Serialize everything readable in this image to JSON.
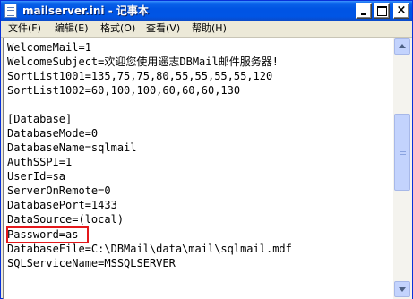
{
  "window": {
    "title": "mailserver.ini - 记事本",
    "icon": "notepad-icon",
    "caption_buttons": {
      "minimize": "minimize-icon",
      "maximize": "maximize-icon",
      "close": "×"
    }
  },
  "menubar": {
    "items": [
      {
        "label": "文件(F)"
      },
      {
        "label": "编辑(E)"
      },
      {
        "label": "格式(O)"
      },
      {
        "label": "查看(V)"
      },
      {
        "label": "帮助(H)"
      }
    ]
  },
  "editor": {
    "lines": [
      "WelcomeMail=1",
      "WelcomeSubject=欢迎您使用遥志DBMail邮件服务器!",
      "SortList1001=135,75,75,80,55,55,55,55,120",
      "SortList1002=60,100,100,60,60,60,130",
      "",
      "[Database]",
      "DatabaseMode=0",
      "DatabaseName=sqlmail",
      "AuthSSPI=1",
      "UserId=sa",
      "ServerOnRemote=0",
      "DatabasePort=1433",
      "DataSource=(local)",
      "Password=as",
      "DatabaseFile=C:\\DBMail\\data\\mail\\sqlmail.mdf",
      "SQLServiceName=MSSQLSERVER"
    ],
    "highlight_color": "#e4181b"
  },
  "scrollbar": {
    "up_icon": "scroll-up-arrow-icon",
    "down_icon": "scroll-down-arrow-icon"
  }
}
